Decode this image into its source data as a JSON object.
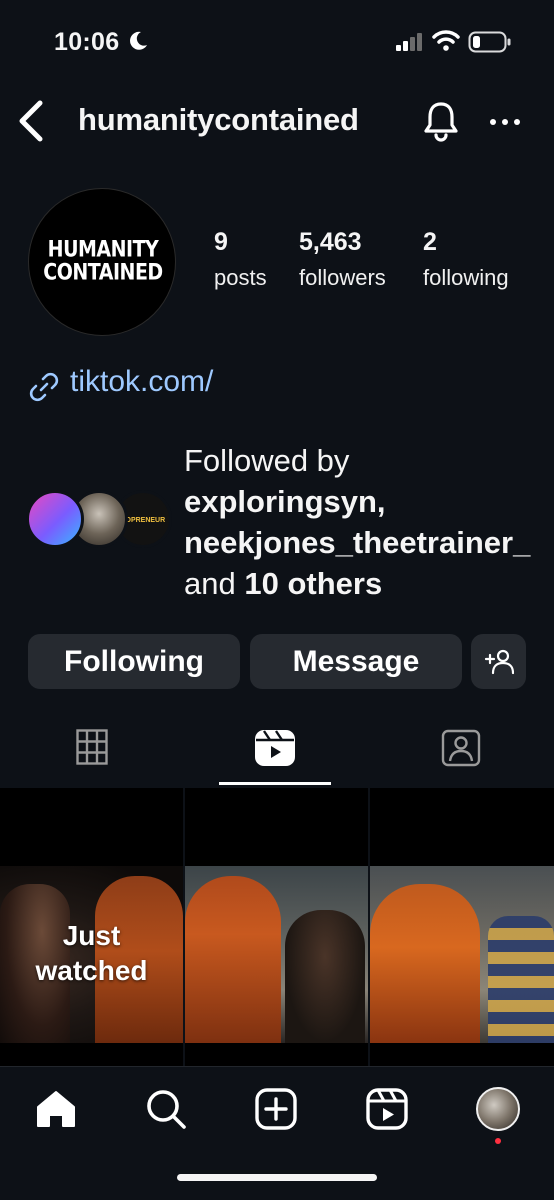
{
  "status_bar": {
    "time": "10:06",
    "icons": [
      "moon-icon",
      "cellular-signal-icon",
      "wifi-icon",
      "battery-icon"
    ]
  },
  "header": {
    "username": "humanitycontained",
    "icons": [
      "back-chevron-icon",
      "bell-icon",
      "more-dots-icon"
    ]
  },
  "profile": {
    "avatar_logo_line1": "HUMANITY",
    "avatar_logo_line2": "CONTAINED",
    "stats": {
      "posts_count": "9",
      "posts_label": "posts",
      "followers_count": "5,463",
      "followers_label": "followers",
      "following_count": "2",
      "following_label": "following"
    },
    "link": "tiktok.com/",
    "followed_by": {
      "prefix": "Followed by",
      "name1": "exploringsyn,",
      "name2": "neekjones_theetrainer_",
      "middle": "and",
      "others": "10 others",
      "avatar3_text": "EOPRENEUR"
    }
  },
  "actions": {
    "following_label": "Following",
    "message_label": "Message",
    "add_user_icon": "add-person-icon"
  },
  "tabs": [
    {
      "name": "grid",
      "icon": "grid-icon",
      "active": false
    },
    {
      "name": "reels",
      "icon": "reels-icon",
      "active": true
    },
    {
      "name": "tagged",
      "icon": "tagged-person-icon",
      "active": false
    }
  ],
  "reels": [
    {
      "overlay_line1": "Just",
      "overlay_line2": "watched"
    },
    {},
    {}
  ],
  "bottom_nav": {
    "items": [
      "home-icon",
      "search-icon",
      "create-icon",
      "reels-icon",
      "profile-avatar"
    ],
    "notification_dot_color": "#ff3040"
  },
  "colors": {
    "background": "#0d1117",
    "button_bg": "#262a30",
    "link": "#9ec9ff"
  }
}
